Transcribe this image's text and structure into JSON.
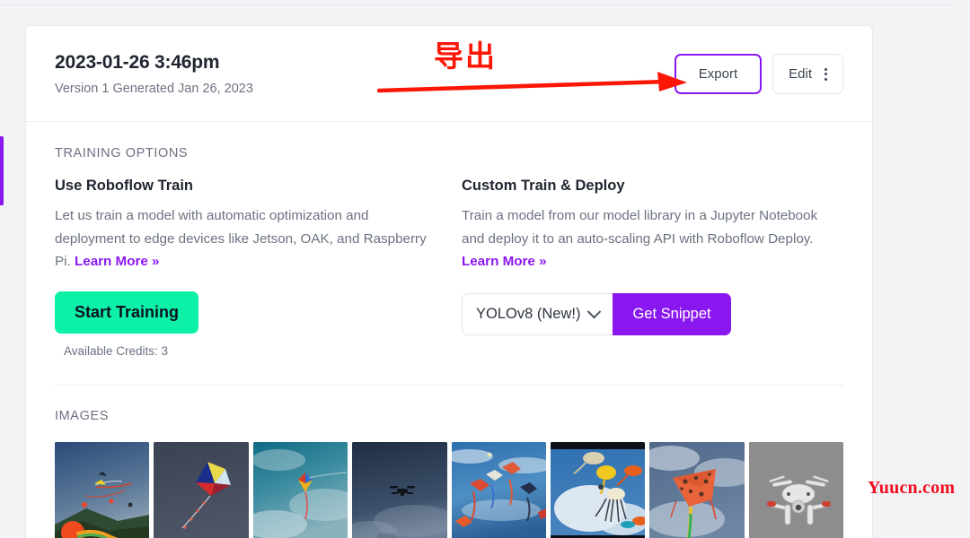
{
  "header": {
    "version_title": "2023-01-26 3:46pm",
    "version_subtitle": "Version 1 Generated Jan 26, 2023",
    "export_label": "Export",
    "edit_label": "Edit",
    "kebab_icon": "more-vertical-icon"
  },
  "training": {
    "section_label": "TRAINING OPTIONS",
    "left": {
      "title": "Use Roboflow Train",
      "description": "Let us train a model with automatic optimization and deployment to edge devices like Jetson, OAK, and Raspberry Pi.",
      "learn_more": "Learn More »",
      "button_label": "Start Training",
      "credits": "Available Credits: 3"
    },
    "right": {
      "title": "Custom Train & Deploy",
      "description": "Train a model from our model library in a Jupyter Notebook and deploy it to an auto-scaling API with Roboflow Deploy.",
      "learn_more": "Learn More »",
      "model_value": "YOLOv8 (New!)",
      "dropdown_icon": "chevron-down-icon",
      "snippet_button_label": "Get Snippet"
    }
  },
  "images": {
    "section_label": "IMAGES",
    "thumbnails": [
      {
        "name": "kites-festival-beach",
        "alt": "Colorful kites over a coastal hillside"
      },
      {
        "name": "diamond-kite-dark-sky",
        "alt": "Blue and yellow diamond kite on dark blue sky"
      },
      {
        "name": "rainbow-kite-teal-sky",
        "alt": "Small rainbow kite against teal clouds"
      },
      {
        "name": "drone-dark-sky",
        "alt": "Quadcopter drone silhouette in dark sky"
      },
      {
        "name": "multiple-kites-blue-sky",
        "alt": "Several kites flying in a bright blue sky"
      },
      {
        "name": "octopus-kites-clouds",
        "alt": "Yellow and black octopus kites above clouds"
      },
      {
        "name": "orange-delta-kite",
        "alt": "Large orange patterned delta kite"
      },
      {
        "name": "white-drone-grey",
        "alt": "White quadcopter drone on grey background"
      }
    ]
  },
  "annotation": {
    "text": "导出",
    "arrow_icon": "right-arrow-annotation",
    "color": "#fb1605"
  },
  "watermark": {
    "text": "Yuucn.com",
    "color": "#f01020"
  },
  "colors": {
    "accent_purple": "#8b17f0",
    "accent_green": "#0df0a8",
    "page_background": "#f2f3f5",
    "card_background": "#ffffff",
    "border": "#e6e8eb",
    "text_primary": "#1f2430",
    "text_muted": "#6b7280"
  }
}
